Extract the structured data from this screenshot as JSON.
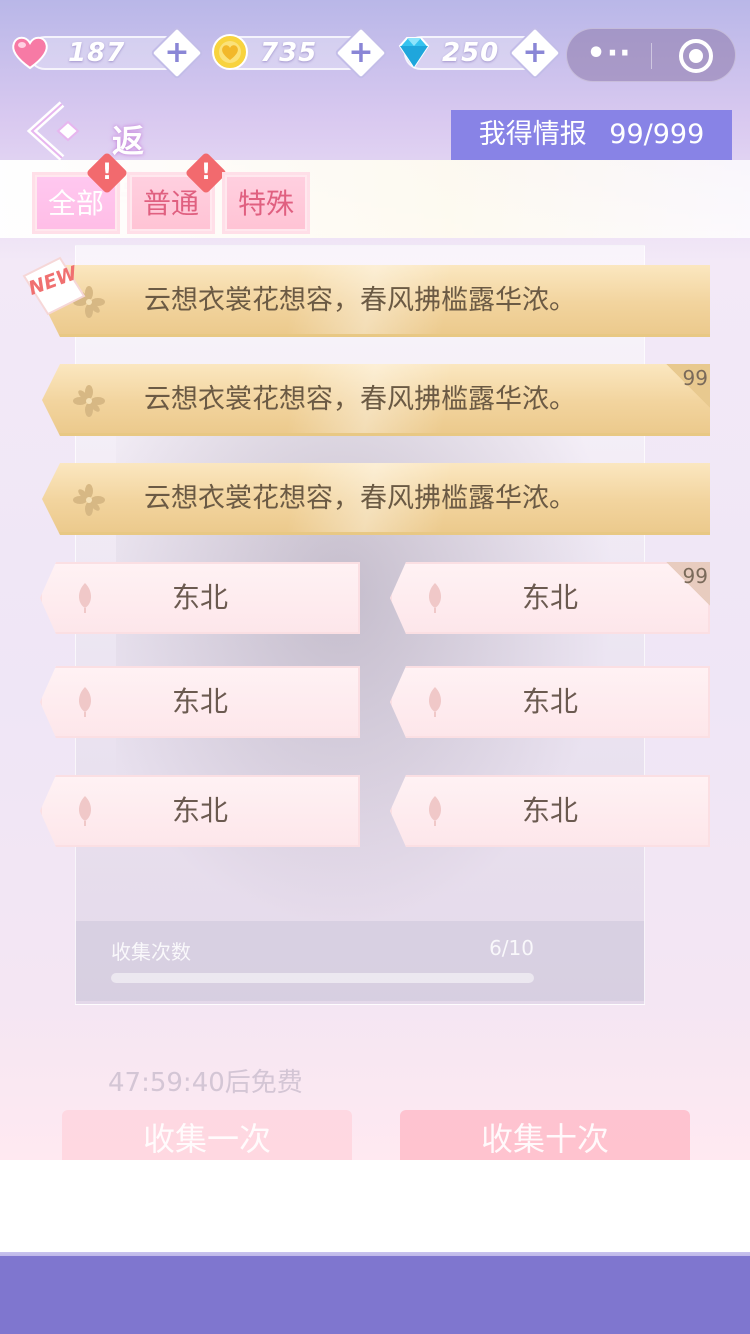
{
  "currency": {
    "hearts": "187",
    "coins": "735",
    "diamonds": "250"
  },
  "capsule": {
    "more": "•··"
  },
  "back": {
    "label": "返回"
  },
  "intel": {
    "label": "我得情报",
    "count": "99/999"
  },
  "tabs": [
    {
      "label": "全部",
      "alert": "!"
    },
    {
      "label": "普通",
      "alert": "!"
    },
    {
      "label": "特殊"
    }
  ],
  "new_tag": "NEW",
  "gold_items": [
    {
      "text": "云想衣裳花想容，春风拂槛露华浓。",
      "count": ""
    },
    {
      "text": "云想衣裳花想容，春风拂槛露华浓。",
      "count": "99"
    },
    {
      "text": "云想衣裳花想容，春风拂槛露华浓。",
      "count": ""
    }
  ],
  "pink_items": [
    {
      "text": "东北",
      "count": ""
    },
    {
      "text": "东北",
      "count": "99"
    },
    {
      "text": "东北",
      "count": ""
    },
    {
      "text": "东北",
      "count": ""
    },
    {
      "text": "东北",
      "count": ""
    },
    {
      "text": "东北",
      "count": ""
    }
  ],
  "background": {
    "collect_label": "收集次数",
    "collect_value": "6/10",
    "timer": "47:59:40后免费",
    "collect_once": "收集一次",
    "collect_ten": "收集十次"
  },
  "colors": {
    "accent": "#8883e6",
    "gold": "#f2d49e",
    "pink": "#fde6ea",
    "alert": "#f26a6e"
  }
}
